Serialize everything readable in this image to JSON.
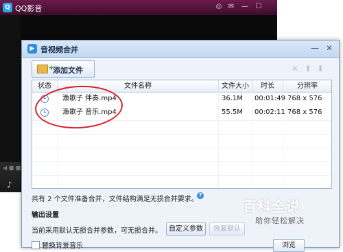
{
  "player": {
    "title": "QQ影音",
    "logo_glyph": "Q",
    "controls": [
      "◎",
      "✉",
      "—",
      "☐"
    ],
    "foot_glyph": "♪",
    "volume_glyph": "◀ ■ ■"
  },
  "dialog": {
    "title": "音视频合并",
    "icon_glyph": "▶",
    "controls": {
      "minimize": "—",
      "close": "✕"
    },
    "add_file_label": "添加文件",
    "toolbar_icons": {
      "remove": "✕",
      "up": "⬆",
      "down": "⬇"
    },
    "table": {
      "headers": [
        "状态",
        "文件名称",
        "文件大小",
        "时长",
        "分辨率"
      ],
      "rows": [
        {
          "name": "渔歌子 伴奏.mp4",
          "size": "36.1M",
          "duration": "00:01:49",
          "resolution": "768 x 576"
        },
        {
          "name": "渔歌子 音乐.mp4",
          "size": "55.5M",
          "duration": "00:02:11",
          "resolution": "768 x 576"
        }
      ]
    },
    "summary": "共有 2 个文件准备合并，文件结构满足无损合并要求。",
    "help_glyph": "?",
    "output_section_title": "输出设置",
    "output_desc": "当前采用默认无损合并参数，可无损合并。",
    "custom_params_label": "自定义参数",
    "restore_default_label": "恢复默认",
    "replace_bg_music_label": "替换背景音乐",
    "browse_label": "浏览"
  },
  "watermark": {
    "title": "百科全说",
    "subtitle": "助你轻松解决"
  },
  "colors": {
    "accent": "#2f8fd8",
    "annotation": "#d8202a",
    "player_title_bg": "#6b1a4c"
  }
}
